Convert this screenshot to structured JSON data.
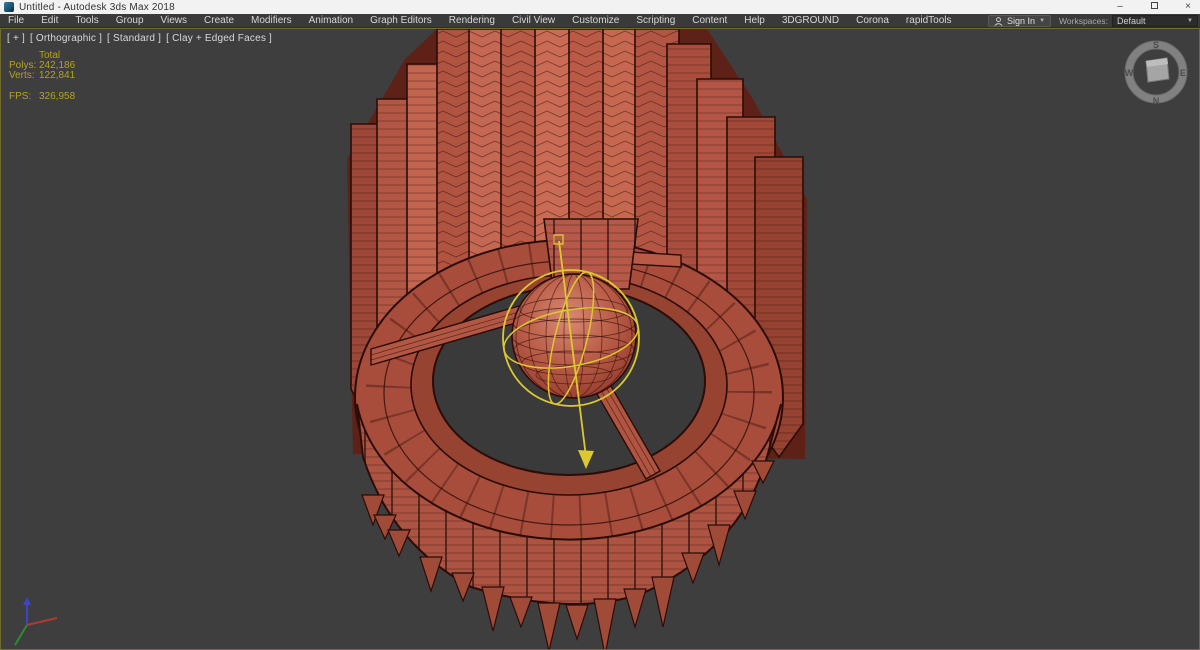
{
  "window": {
    "title": "Untitled - Autodesk 3ds Max 2018"
  },
  "menubar": {
    "items": [
      "File",
      "Edit",
      "Tools",
      "Group",
      "Views",
      "Create",
      "Modifiers",
      "Animation",
      "Graph Editors",
      "Rendering",
      "Civil View",
      "Customize",
      "Scripting",
      "Content",
      "Help",
      "3DGROUND",
      "Corona",
      "rapidTools"
    ]
  },
  "account": {
    "sign_in": "Sign In",
    "workspaces_label": "Workspaces:",
    "workspace_value": "Default"
  },
  "viewport": {
    "label_plus": "[ + ]",
    "label_pov": "[ Orthographic ]",
    "label_style": "[ Standard ]",
    "label_shading": "[ Clay + Edged Faces ]"
  },
  "stats": {
    "header": "Total",
    "rows": [
      {
        "label": "Polys:",
        "value": "242,186"
      },
      {
        "label": "Verts:",
        "value": "122,841"
      }
    ],
    "fps_label": "FPS:",
    "fps_value": "326,958"
  },
  "viewcube": {
    "north": "N",
    "south": "S",
    "east": "E",
    "west": "W"
  },
  "colors": {
    "viewport-bg": "#3e3e3e",
    "active-border": "#716b2d",
    "stats-text": "#b3a41e",
    "model-base": "#b25744",
    "model-light": "#c96b55",
    "model-dark": "#954231",
    "model-edge": "#2b0c08",
    "gizmo": "#ddc832",
    "axis-x": "#b03a2e",
    "axis-y": "#2e8b33",
    "axis-z": "#3a46c8"
  }
}
